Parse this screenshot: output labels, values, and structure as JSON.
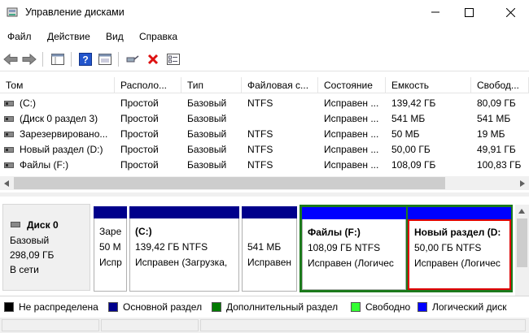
{
  "window": {
    "title": "Управление дисками"
  },
  "menu": [
    "Файл",
    "Действие",
    "Вид",
    "Справка"
  ],
  "toolbar": {
    "icons": [
      "back-icon",
      "forward-icon",
      "properties-panel-icon",
      "help-icon",
      "console-view-icon",
      "connect-icon",
      "delete-icon",
      "checklist-icon"
    ]
  },
  "volumes": {
    "headers": [
      "Том",
      "Располо...",
      "Тип",
      "Файловая с...",
      "Состояние",
      "Емкость",
      "Свобод..."
    ],
    "rows": [
      [
        "(C:)",
        "Простой",
        "Базовый",
        "NTFS",
        "Исправен ...",
        "139,42 ГБ",
        "80,09 ГБ"
      ],
      [
        "(Диск 0 раздел 3)",
        "Простой",
        "Базовый",
        "",
        "Исправен ...",
        "541 МБ",
        "541 МБ"
      ],
      [
        "Зарезервировано...",
        "Простой",
        "Базовый",
        "NTFS",
        "Исправен ...",
        "50 МБ",
        "19 МБ"
      ],
      [
        "Новый раздел (D:)",
        "Простой",
        "Базовый",
        "NTFS",
        "Исправен ...",
        "50,00 ГБ",
        "49,91 ГБ"
      ],
      [
        "Файлы (F:)",
        "Простой",
        "Базовый",
        "NTFS",
        "Исправен ...",
        "108,09 ГБ",
        "100,83 ГБ"
      ]
    ]
  },
  "disk": {
    "name": "Диск 0",
    "type": "Базовый",
    "size": "298,09 ГБ",
    "status": "В сети"
  },
  "partitions": [
    {
      "line1": "Заре",
      "line2": "50 М",
      "line3": "Испр",
      "bar_color": "#00008b",
      "bold": false
    },
    {
      "line1": "(C:)",
      "line2": "139,42 ГБ NTFS",
      "line3": "Исправен (Загрузка,",
      "bar_color": "#00008b",
      "bold": true
    },
    {
      "line1": "",
      "line2": "541 МБ",
      "line3": "Исправен",
      "bar_color": "#00008b",
      "bold": false
    },
    {
      "line1": "Файлы  (F:)",
      "line2": "108,09 ГБ NTFS",
      "line3": "Исправен (Логичес",
      "bar_color": "#0000ff",
      "bold": true
    },
    {
      "line1": "Новый раздел  (D:",
      "line2": "50,00 ГБ NTFS",
      "line3": "Исправен (Логичес",
      "bar_color": "#0000ff",
      "bold": true
    }
  ],
  "legend": [
    {
      "label": "Не распределена",
      "color": "#000000"
    },
    {
      "label": "Основной раздел",
      "color": "#00008b"
    },
    {
      "label": "Дополнительный раздел",
      "color": "#007a00"
    },
    {
      "label": "Свободно",
      "color": "#33ff33"
    },
    {
      "label": "Логический диск",
      "color": "#0000ff"
    }
  ],
  "colors": {
    "extended_border": "#1c7a1c",
    "selected_border": "#e00000"
  }
}
